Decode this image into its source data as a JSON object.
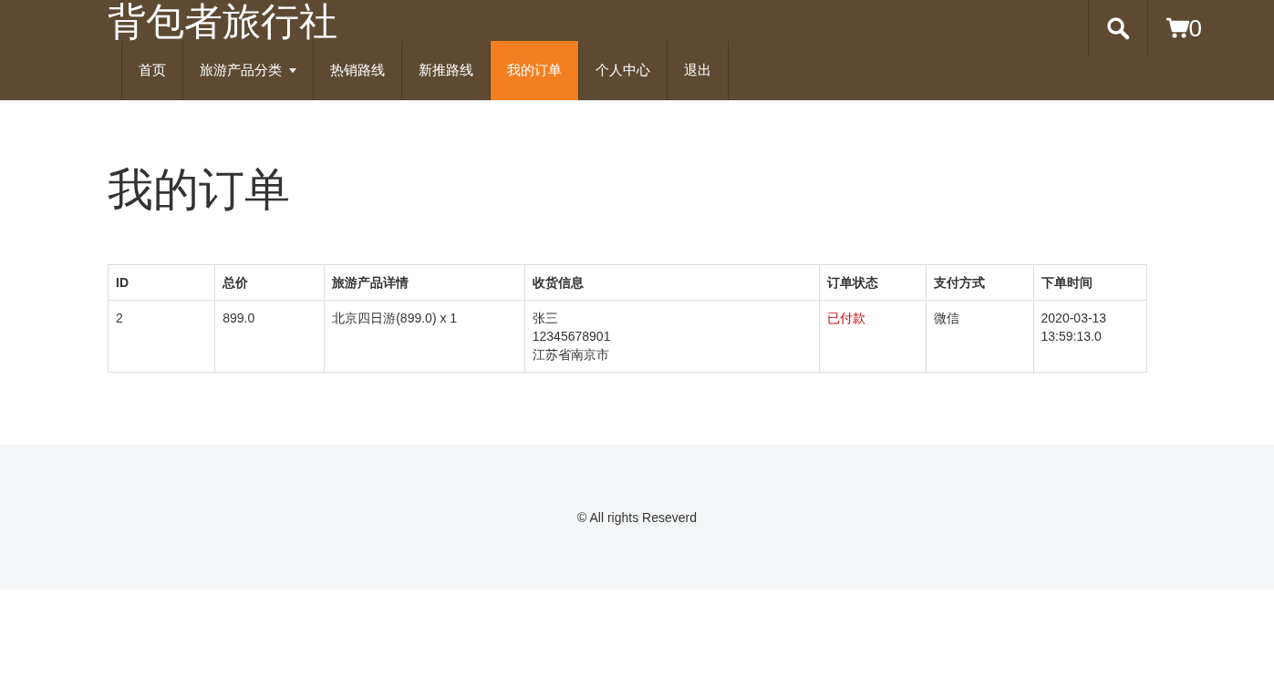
{
  "header": {
    "brand": "背包者旅行社",
    "cart_count": "0"
  },
  "nav": [
    {
      "label": "首页",
      "selected": false,
      "dropdown": false
    },
    {
      "label": "旅游产品分类",
      "selected": false,
      "dropdown": true
    },
    {
      "label": "热销路线",
      "selected": false,
      "dropdown": false
    },
    {
      "label": "新推路线",
      "selected": false,
      "dropdown": false
    },
    {
      "label": "我的订单",
      "selected": true,
      "dropdown": false
    },
    {
      "label": "个人中心",
      "selected": false,
      "dropdown": false
    },
    {
      "label": "退出",
      "selected": false,
      "dropdown": false
    }
  ],
  "page_title": "我的订单",
  "table": {
    "columns": [
      "ID",
      "总价",
      "旅游产品详情",
      "收货信息",
      "订单状态",
      "支付方式",
      "下单时间"
    ],
    "rows": [
      {
        "id": "2",
        "total": "899.0",
        "product": "北京四日游(899.0) x 1",
        "shipping": [
          "张三",
          "12345678901",
          "江苏省南京市"
        ],
        "status": "已付款",
        "payment": "微信",
        "time": [
          "2020-03-13",
          "13:59:13.0"
        ]
      }
    ]
  },
  "footer": {
    "text": "© All rights Reseverd"
  }
}
